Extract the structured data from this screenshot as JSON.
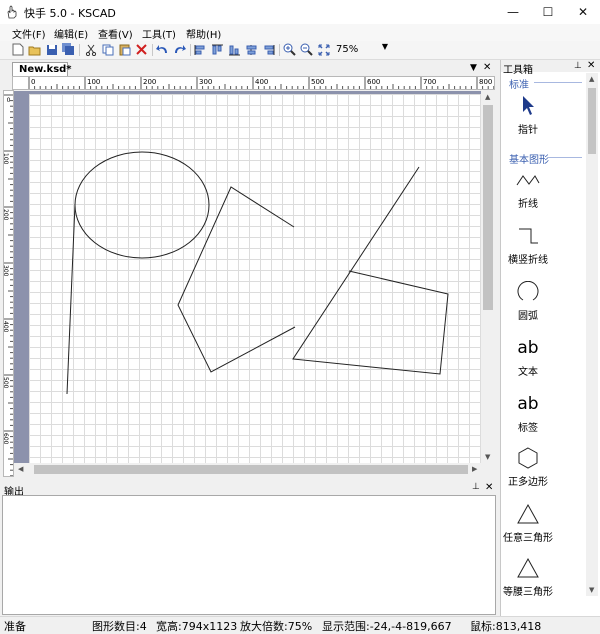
{
  "window": {
    "title": "快手 5.0 - KSCAD",
    "minimize": "—",
    "maximize": "☐",
    "close": "✕"
  },
  "menu": [
    "文件(F)",
    "编辑(E)",
    "查看(V)",
    "工具(T)",
    "帮助(H)"
  ],
  "toolbar": {
    "icons": [
      "new-icon",
      "open-icon",
      "save-icon",
      "save-all-icon",
      "cut-icon",
      "copy-icon",
      "paste-icon",
      "delete-icon",
      "undo-icon",
      "redo-icon",
      "align-left-icon",
      "align-top-icon",
      "align-bottom-icon",
      "align-center-icon",
      "align-right-icon",
      "zoom-in-icon",
      "zoom-out-icon",
      "fit-icon"
    ],
    "zoom": "75%"
  },
  "document": {
    "tab": "New.ksd*"
  },
  "rulers": {
    "top": [
      "0",
      "100",
      "200",
      "300",
      "400",
      "500",
      "600",
      "700",
      "800"
    ],
    "left": [
      "0",
      "100",
      "200",
      "300",
      "400",
      "500",
      "600"
    ]
  },
  "output": {
    "title": "输出"
  },
  "toolbox": {
    "title": "工具箱",
    "category_standard": "标准",
    "category_basic": "基本图形",
    "tools": [
      "指针",
      "折线",
      "横竖折线",
      "圆弧",
      "文本",
      "标签",
      "正多边形",
      "任意三角形",
      "等腰三角形"
    ],
    "text_glyph": "ab"
  },
  "status": {
    "ready": "准备",
    "count": "图形数目:4",
    "size": "宽高:794x1123",
    "zoom": "放大倍数:75%",
    "range": "显示范围:-24,-4-819,667",
    "coords": "鼠标:813,418"
  },
  "colors": {
    "canvas_border": "#8c92ac",
    "category": "#3a5fb0"
  }
}
